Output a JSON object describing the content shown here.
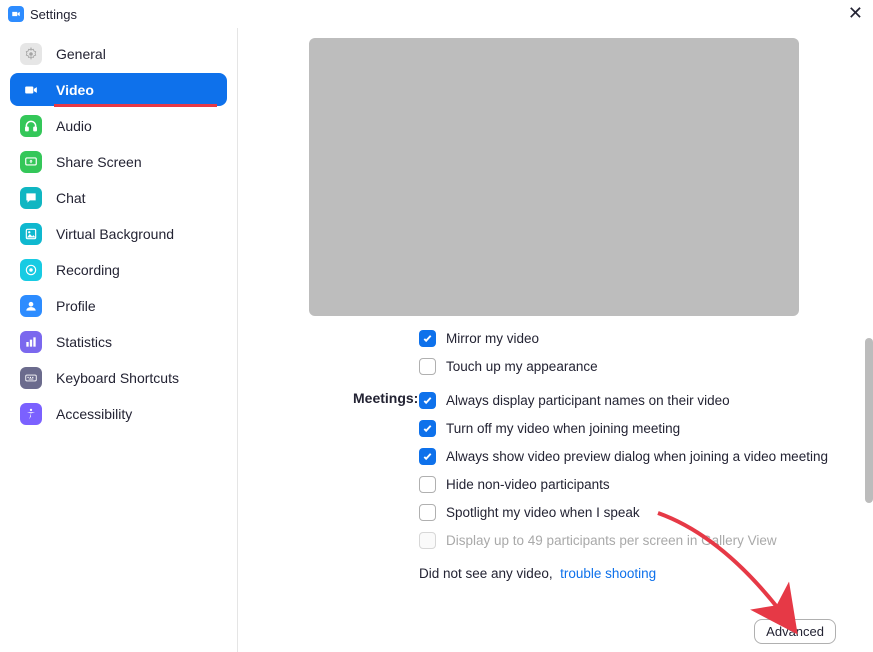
{
  "window": {
    "title": "Settings"
  },
  "sidebar": {
    "items": [
      {
        "label": "General",
        "icon": "gear-icon",
        "color": "#c9c9c9"
      },
      {
        "label": "Video",
        "icon": "video-icon",
        "color": "#ffffff",
        "active": true
      },
      {
        "label": "Audio",
        "icon": "headphones-icon",
        "color": "#34c759"
      },
      {
        "label": "Share Screen",
        "icon": "share-screen-icon",
        "color": "#34c759"
      },
      {
        "label": "Chat",
        "icon": "chat-icon",
        "color": "#10b6c2"
      },
      {
        "label": "Virtual Background",
        "icon": "virtual-bg-icon",
        "color": "#0fb8cf"
      },
      {
        "label": "Recording",
        "icon": "recording-icon",
        "color": "#18cbe3"
      },
      {
        "label": "Profile",
        "icon": "profile-icon",
        "color": "#2d8cff"
      },
      {
        "label": "Statistics",
        "icon": "statistics-icon",
        "color": "#7b68ee"
      },
      {
        "label": "Keyboard Shortcuts",
        "icon": "keyboard-icon",
        "color": "#6b6b8d"
      },
      {
        "label": "Accessibility",
        "icon": "accessibility-icon",
        "color": "#7b61ff"
      }
    ]
  },
  "main": {
    "partial_option": {
      "label": "Mirror my video",
      "checked": true
    },
    "touch_up": {
      "label": "Touch up my appearance",
      "checked": false
    },
    "section_meetings": "Meetings:",
    "meetings_opts": [
      {
        "label": "Always display participant names on their video",
        "checked": true
      },
      {
        "label": "Turn off my video when joining meeting",
        "checked": true
      },
      {
        "label": "Always show video preview dialog when joining a video meeting",
        "checked": true
      },
      {
        "label": "Hide non-video participants",
        "checked": false
      },
      {
        "label": "Spotlight my video when I speak",
        "checked": false
      },
      {
        "label": "Display up to 49 participants per screen in Gallery View",
        "checked": false,
        "disabled": true
      }
    ],
    "help_text": "Did not see any video,",
    "help_link": "trouble shooting",
    "advanced_label": "Advanced"
  }
}
